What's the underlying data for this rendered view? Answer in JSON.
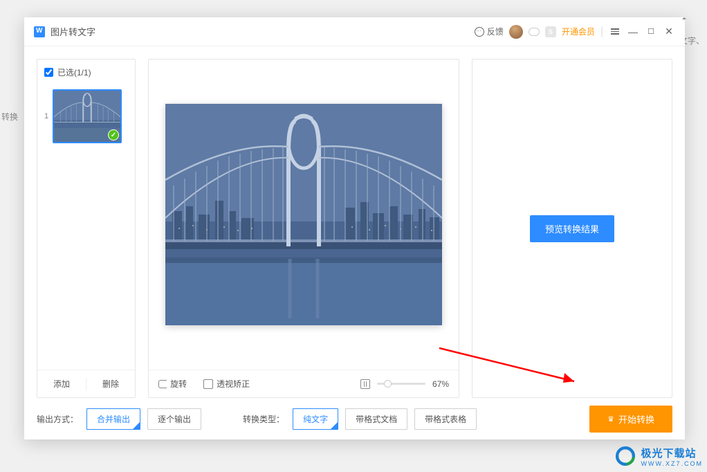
{
  "bg": {
    "t4": "文字、",
    "t5": "转换"
  },
  "titlebar": {
    "title": "图片转文字",
    "feedback": "反馈",
    "vip": "开通会员"
  },
  "left": {
    "selected_label": "已选(1/1)",
    "thumb_index": "1",
    "add": "添加",
    "delete": "删除"
  },
  "mid": {
    "rotate": "旋转",
    "perspective": "透视矫正",
    "zoom": "67%"
  },
  "right": {
    "preview_btn": "预览转换结果"
  },
  "footer": {
    "output_label": "输出方式：",
    "merge": "合并输出",
    "each": "逐个输出",
    "type_label": "转换类型：",
    "plain": "纯文字",
    "doc": "带格式文档",
    "table": "带格式表格",
    "start": "开始转换"
  },
  "watermark": {
    "cn": "极光下载站",
    "en": "WWW.XZ7.COM"
  }
}
